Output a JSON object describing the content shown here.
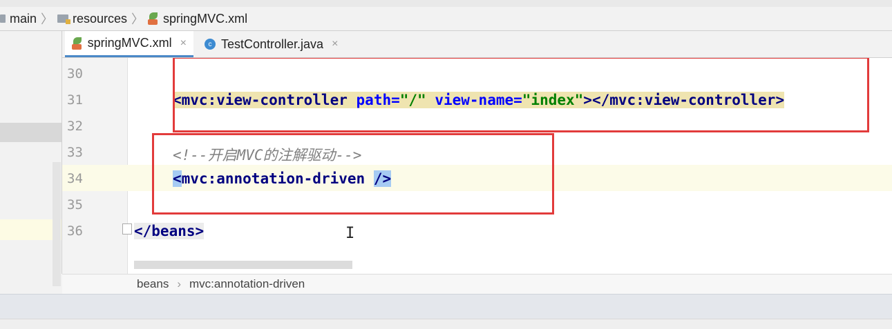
{
  "breadcrumb": {
    "items": [
      "main",
      "resources",
      "springMVC.xml"
    ]
  },
  "tabs": [
    {
      "label": "springMVC.xml",
      "active": true
    },
    {
      "label": "TestController.java",
      "active": false
    }
  ],
  "tab_close_glyph": "×",
  "editor": {
    "lines": [
      {
        "num": "30"
      },
      {
        "num": "31"
      },
      {
        "num": "32"
      },
      {
        "num": "33"
      },
      {
        "num": "34"
      },
      {
        "num": "35"
      },
      {
        "num": "36"
      }
    ],
    "line31": {
      "open": "<mvc:view-controller",
      "attr1": "path=",
      "val1": "\"/\"",
      "attr2": "view-name=",
      "val2": "\"index\"",
      "close": "></mvc:view-controller>"
    },
    "line33": {
      "comment": "<!--开启MVC的注解驱动-->"
    },
    "line34": {
      "open": "<mvc:annotation-driven",
      "selfclose": "/>"
    },
    "line36": {
      "tag": "</beans>"
    }
  },
  "editor_breadcrumb": [
    "beans",
    "mvc:annotation-driven"
  ],
  "colors": {
    "highlight_box": "#e23b3b",
    "tag": "#000080",
    "attr": "#0000ff",
    "string": "#008000",
    "comment": "#808080"
  }
}
